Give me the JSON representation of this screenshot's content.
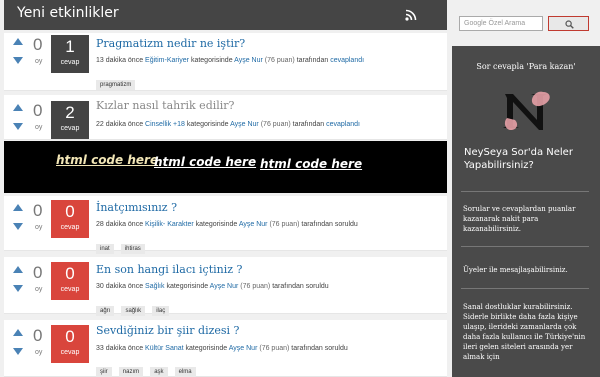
{
  "header": {
    "title": "Yeni etkinlikler",
    "rss_icon": "rss-icon"
  },
  "questions": [
    {
      "votes": "0",
      "vote_label": "oy",
      "answers": "1",
      "answer_label": "cevap",
      "state": "answered",
      "title": "Pragmatizm nedir ne iştir?",
      "visited": false,
      "time": "13 dakika önce",
      "category": "Eğitim-Kariyer",
      "cat_text": "kategorisinde",
      "user": "Ayşe Nur",
      "points": "(76 puan)",
      "by_text": "tarafından",
      "action": "cevaplandı",
      "tags": [
        "pragmatizm"
      ]
    },
    {
      "votes": "0",
      "vote_label": "oy",
      "answers": "2",
      "answer_label": "cevap",
      "state": "answered",
      "title": "Kızlar nasıl tahrik edilir?",
      "visited": true,
      "time": "22 dakika önce",
      "category": "Cinsellik +18",
      "cat_text": "kategorisinde",
      "user": "Ayşe Nur",
      "points": "(76 puan)",
      "by_text": "tarafından",
      "action": "cevaplandı",
      "tags": []
    },
    {
      "votes": "0",
      "vote_label": "oy",
      "answers": "0",
      "answer_label": "cevap",
      "state": "open",
      "title": "İnatçımısınız ?",
      "visited": false,
      "time": "28 dakika önce",
      "category": "Kişilik- Karakter",
      "cat_text": "kategorisinde",
      "user": "Ayşe Nur",
      "points": "(76 puan)",
      "by_text": "tarafından",
      "action": "soruldu",
      "tags": [
        "inat",
        "ihtiras"
      ]
    },
    {
      "votes": "0",
      "vote_label": "oy",
      "answers": "0",
      "answer_label": "cevap",
      "state": "open",
      "title": "En son hangi ilacı içtiniz ?",
      "visited": false,
      "time": "30 dakika önce",
      "category": "Sağlık",
      "cat_text": "kategorisinde",
      "user": "Ayşe Nur",
      "points": "(76 puan)",
      "by_text": "tarafından",
      "action": "soruldu",
      "tags": [
        "ağrı",
        "sağlık",
        "ilaç"
      ]
    },
    {
      "votes": "0",
      "vote_label": "oy",
      "answers": "0",
      "answer_label": "cevap",
      "state": "open",
      "title": "Sevdiğiniz bir şiir dizesi ?",
      "visited": false,
      "time": "33 dakika önce",
      "category": "Kültür Sanat",
      "cat_text": "kategorisinde",
      "user": "Ayşe Nur",
      "points": "(76 puan)",
      "by_text": "tarafından",
      "action": "soruldu",
      "tags": [
        "şiir",
        "nazım",
        "aşk",
        "elma"
      ]
    }
  ],
  "banner": {
    "items": [
      "html code here",
      "html code here",
      "html code here"
    ]
  },
  "search": {
    "placeholder": "Google Özel Arama",
    "button_icon": "search-icon"
  },
  "sidebar": {
    "subtitle": "Sor cevapla 'Para kazan'",
    "logo_letter": "N",
    "heading": "NeySeya Sor'da Neler Yapabilirsiniz?",
    "paragraphs": [
      "Sorular ve cevaplardan puanlar kazanarak nakit para kazanabilirsiniz.",
      "Üyeler ile mesajlaşabilirsiniz.",
      "Sanal dostluklar kurabilirsiniz. Siderle birlikte daha fazla kişiye ulaşıp, ilerideki zamanlarda çok daha fazla kullanıcı ile Türkiye'nin ileri gelen siteleri arasında yer almak için"
    ]
  },
  "colors": {
    "link": "#1f6aa5",
    "answered": "#444444",
    "open": "#d9453c",
    "header": "#454545",
    "sidebar": "#4a4a4a"
  }
}
